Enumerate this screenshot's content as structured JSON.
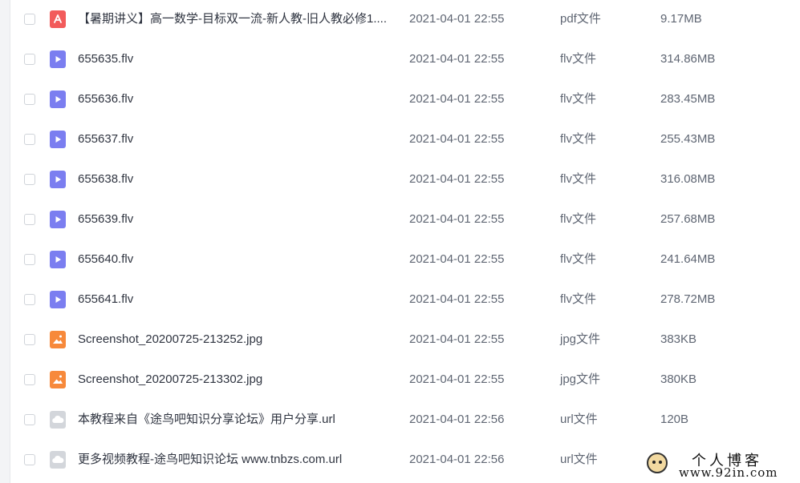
{
  "files": [
    {
      "name": "【暑期讲义】高一数学-目标双一流-新人教-旧人教必修1....",
      "date": "2021-04-01 22:55",
      "type": "pdf文件",
      "size": "9.17MB",
      "icon": "pdf-icon"
    },
    {
      "name": "655635.flv",
      "date": "2021-04-01 22:55",
      "type": "flv文件",
      "size": "314.86MB",
      "icon": "video-icon"
    },
    {
      "name": "655636.flv",
      "date": "2021-04-01 22:55",
      "type": "flv文件",
      "size": "283.45MB",
      "icon": "video-icon"
    },
    {
      "name": "655637.flv",
      "date": "2021-04-01 22:55",
      "type": "flv文件",
      "size": "255.43MB",
      "icon": "video-icon"
    },
    {
      "name": "655638.flv",
      "date": "2021-04-01 22:55",
      "type": "flv文件",
      "size": "316.08MB",
      "icon": "video-icon"
    },
    {
      "name": "655639.flv",
      "date": "2021-04-01 22:55",
      "type": "flv文件",
      "size": "257.68MB",
      "icon": "video-icon"
    },
    {
      "name": "655640.flv",
      "date": "2021-04-01 22:55",
      "type": "flv文件",
      "size": "241.64MB",
      "icon": "video-icon"
    },
    {
      "name": "655641.flv",
      "date": "2021-04-01 22:55",
      "type": "flv文件",
      "size": "278.72MB",
      "icon": "video-icon"
    },
    {
      "name": "Screenshot_20200725-213252.jpg",
      "date": "2021-04-01 22:55",
      "type": "jpg文件",
      "size": "383KB",
      "icon": "image-icon"
    },
    {
      "name": "Screenshot_20200725-213302.jpg",
      "date": "2021-04-01 22:55",
      "type": "jpg文件",
      "size": "380KB",
      "icon": "image-icon"
    },
    {
      "name": "本教程来自《途鸟吧知识分享论坛》用户分享.url",
      "date": "2021-04-01 22:56",
      "type": "url文件",
      "size": "120B",
      "icon": "link-icon"
    },
    {
      "name": "更多视频教程-途鸟吧知识论坛 www.tnbzs.com.url",
      "date": "2021-04-01 22:56",
      "type": "url文件",
      "size": "",
      "icon": "link-icon"
    }
  ],
  "colors": {
    "pdf": "#f25b5b",
    "video": "#7b7ef0",
    "image": "#f7893b",
    "link": "#d3d6db"
  },
  "watermark": {
    "title": "个人博客",
    "url": "www.92in.com"
  }
}
